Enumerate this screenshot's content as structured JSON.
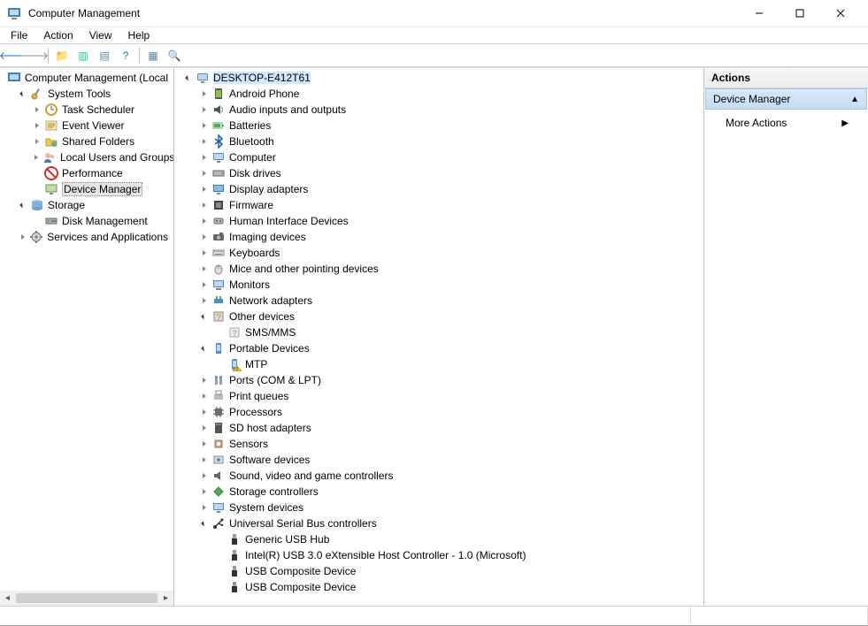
{
  "window": {
    "title": "Computer Management"
  },
  "menubar": [
    "File",
    "Action",
    "View",
    "Help"
  ],
  "toolbar_icons": [
    {
      "name": "back-icon",
      "glyph": "🡐",
      "color": "#1a6fd2"
    },
    {
      "name": "forward-icon",
      "glyph": "🡒",
      "color": "#888"
    },
    {
      "name": "up-folder-icon",
      "glyph": "📁",
      "color": "#d6a13a"
    },
    {
      "name": "show-hide-tree-icon",
      "glyph": "▥",
      "color": "#2c7"
    },
    {
      "name": "properties-icon",
      "glyph": "▤",
      "color": "#58a"
    },
    {
      "name": "help-icon",
      "glyph": "?",
      "color": "#2174c7"
    },
    {
      "name": "refresh-icon",
      "glyph": "▦",
      "color": "#58a"
    },
    {
      "name": "scan-hardware-icon",
      "glyph": "🔍",
      "color": "#555"
    }
  ],
  "tree_left": [
    {
      "depth": 0,
      "caret": "",
      "icon": "compmgmt",
      "label": "Computer Management (Local"
    },
    {
      "depth": 1,
      "caret": "open",
      "icon": "tools",
      "label": "System Tools"
    },
    {
      "depth": 2,
      "caret": "right",
      "icon": "clock",
      "label": "Task Scheduler"
    },
    {
      "depth": 2,
      "caret": "right",
      "icon": "eventviewer",
      "label": "Event Viewer"
    },
    {
      "depth": 2,
      "caret": "right",
      "icon": "sharedfolders",
      "label": "Shared Folders"
    },
    {
      "depth": 2,
      "caret": "right",
      "icon": "localusers",
      "label": "Local Users and Groups"
    },
    {
      "depth": 2,
      "caret": "",
      "icon": "performance",
      "label": "Performance"
    },
    {
      "depth": 2,
      "caret": "",
      "icon": "devmgr",
      "label": "Device Manager",
      "selected": true
    },
    {
      "depth": 1,
      "caret": "open",
      "icon": "storage",
      "label": "Storage"
    },
    {
      "depth": 2,
      "caret": "",
      "icon": "diskmgmt",
      "label": "Disk Management"
    },
    {
      "depth": 1,
      "caret": "right",
      "icon": "services",
      "label": "Services and Applications"
    }
  ],
  "computer_name": "DESKTOP-E412T61",
  "devices": [
    {
      "caret": "open",
      "icon": "computer",
      "label": "DESKTOP-E412T61",
      "depth": 0,
      "selected": true
    },
    {
      "caret": "right",
      "icon": "android",
      "label": "Android Phone",
      "depth": 1
    },
    {
      "caret": "right",
      "icon": "audio",
      "label": "Audio inputs and outputs",
      "depth": 1
    },
    {
      "caret": "right",
      "icon": "battery",
      "label": "Batteries",
      "depth": 1
    },
    {
      "caret": "right",
      "icon": "bluetooth",
      "label": "Bluetooth",
      "depth": 1
    },
    {
      "caret": "right",
      "icon": "computer",
      "label": "Computer",
      "depth": 1
    },
    {
      "caret": "right",
      "icon": "disk",
      "label": "Disk drives",
      "depth": 1
    },
    {
      "caret": "right",
      "icon": "display",
      "label": "Display adapters",
      "depth": 1
    },
    {
      "caret": "right",
      "icon": "firmware",
      "label": "Firmware",
      "depth": 1
    },
    {
      "caret": "right",
      "icon": "hid",
      "label": "Human Interface Devices",
      "depth": 1
    },
    {
      "caret": "right",
      "icon": "imaging",
      "label": "Imaging devices",
      "depth": 1
    },
    {
      "caret": "right",
      "icon": "keyboard",
      "label": "Keyboards",
      "depth": 1
    },
    {
      "caret": "right",
      "icon": "mouse",
      "label": "Mice and other pointing devices",
      "depth": 1
    },
    {
      "caret": "right",
      "icon": "monitor",
      "label": "Monitors",
      "depth": 1
    },
    {
      "caret": "right",
      "icon": "network",
      "label": "Network adapters",
      "depth": 1
    },
    {
      "caret": "open",
      "icon": "other",
      "label": "Other devices",
      "depth": 1
    },
    {
      "caret": "",
      "icon": "unknown",
      "label": "SMS/MMS",
      "depth": 2
    },
    {
      "caret": "open",
      "icon": "portable",
      "label": "Portable Devices",
      "depth": 1
    },
    {
      "caret": "",
      "icon": "mtpwarn",
      "label": "MTP",
      "depth": 2
    },
    {
      "caret": "right",
      "icon": "ports",
      "label": "Ports (COM & LPT)",
      "depth": 1
    },
    {
      "caret": "right",
      "icon": "printqueue",
      "label": "Print queues",
      "depth": 1
    },
    {
      "caret": "right",
      "icon": "processor",
      "label": "Processors",
      "depth": 1
    },
    {
      "caret": "right",
      "icon": "sdhost",
      "label": "SD host adapters",
      "depth": 1
    },
    {
      "caret": "right",
      "icon": "sensor",
      "label": "Sensors",
      "depth": 1
    },
    {
      "caret": "right",
      "icon": "software",
      "label": "Software devices",
      "depth": 1
    },
    {
      "caret": "right",
      "icon": "sound",
      "label": "Sound, video and game controllers",
      "depth": 1
    },
    {
      "caret": "right",
      "icon": "storagectrl",
      "label": "Storage controllers",
      "depth": 1
    },
    {
      "caret": "right",
      "icon": "system",
      "label": "System devices",
      "depth": 1
    },
    {
      "caret": "open",
      "icon": "usb",
      "label": "Universal Serial Bus controllers",
      "depth": 1
    },
    {
      "caret": "",
      "icon": "usbplug",
      "label": "Generic USB Hub",
      "depth": 2
    },
    {
      "caret": "",
      "icon": "usbplug",
      "label": "Intel(R) USB 3.0 eXtensible Host Controller - 1.0 (Microsoft)",
      "depth": 2
    },
    {
      "caret": "",
      "icon": "usbplug",
      "label": "USB Composite Device",
      "depth": 2
    },
    {
      "caret": "",
      "icon": "usbplug",
      "label": "USB Composite Device",
      "depth": 2
    }
  ],
  "actions": {
    "header": "Actions",
    "group_title": "Device Manager",
    "items": [
      "More Actions"
    ]
  }
}
